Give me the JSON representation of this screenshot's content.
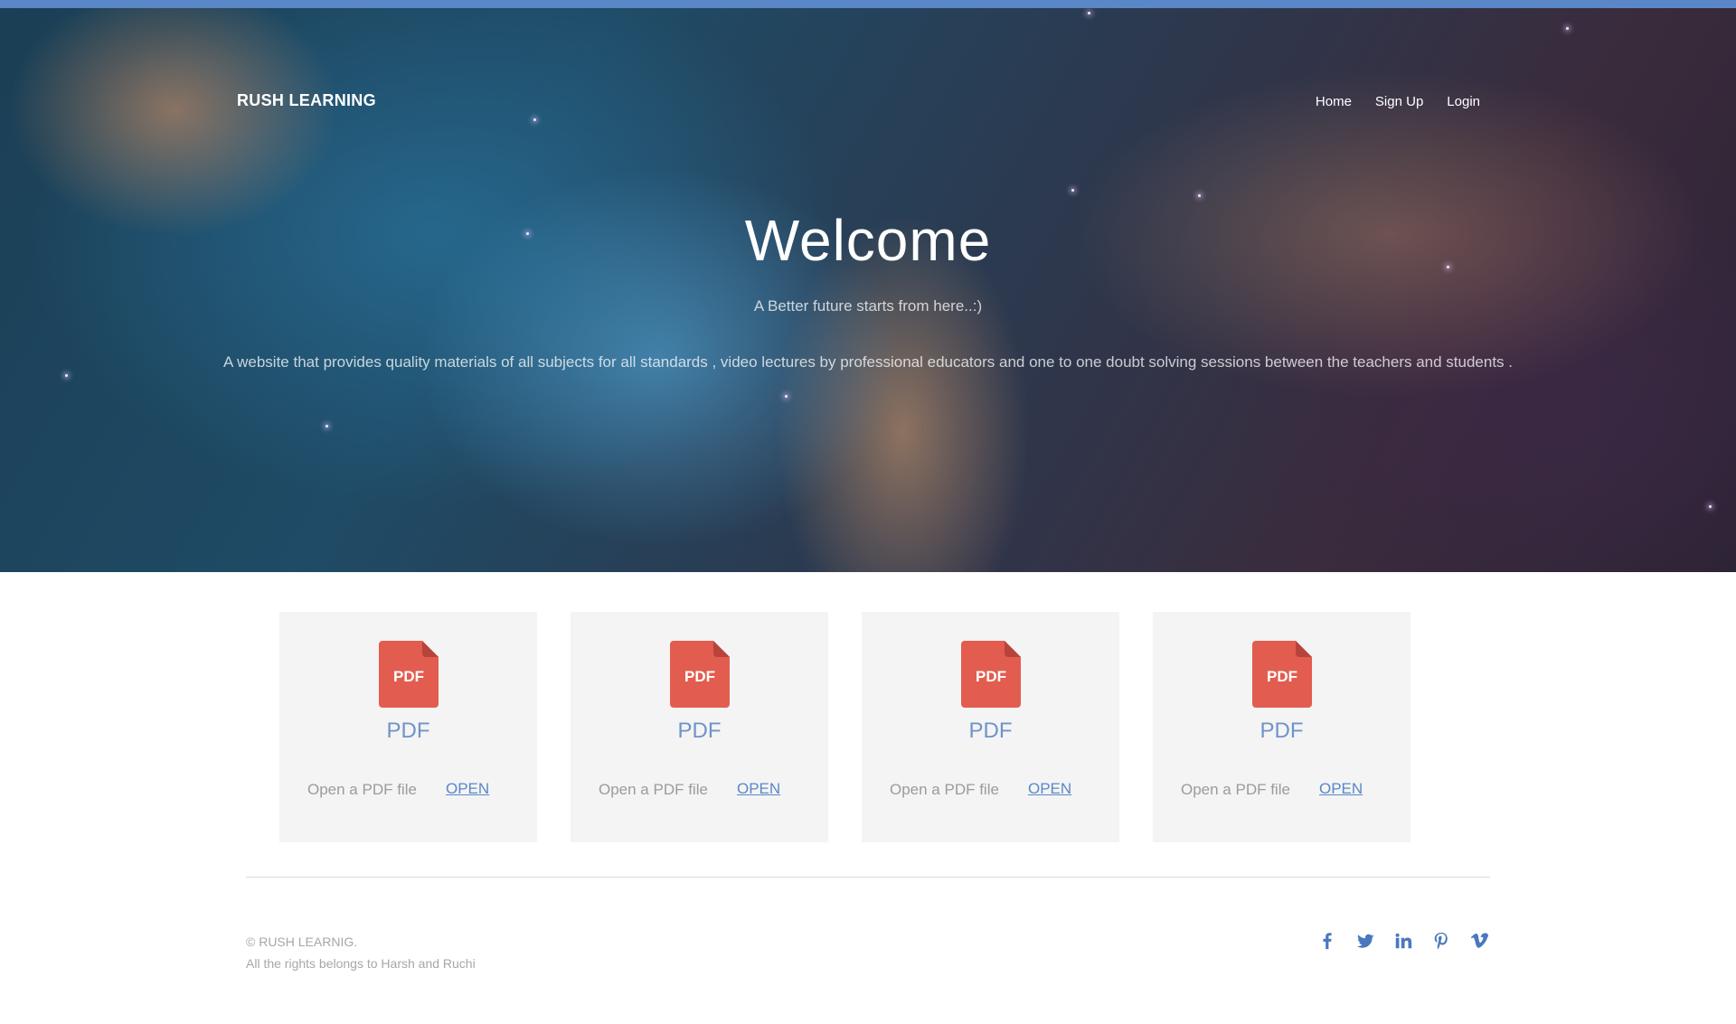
{
  "brand": "RUSH LEARNING",
  "nav": {
    "home": "Home",
    "signup": "Sign Up",
    "login": "Login"
  },
  "hero": {
    "title": "Welcome",
    "subtitle": "A Better future starts from here..:)",
    "description": "A website that provides quality materials of all subjects for all standards , video lectures by professional educators and one to one doubt solving sessions between the teachers and students ."
  },
  "cards": [
    {
      "icon": "pdf-icon",
      "icon_text": "PDF",
      "title": "PDF",
      "text": "Open a PDF file",
      "link": "OPEN"
    },
    {
      "icon": "pdf-icon",
      "icon_text": "PDF",
      "title": "PDF",
      "text": "Open a PDF file",
      "link": "OPEN"
    },
    {
      "icon": "pdf-icon",
      "icon_text": "PDF",
      "title": "PDF",
      "text": "Open a PDF file",
      "link": "OPEN"
    },
    {
      "icon": "pdf-icon",
      "icon_text": "PDF",
      "title": "PDF",
      "text": "Open a PDF file",
      "link": "OPEN"
    }
  ],
  "footer": {
    "copyright": "© RUSH LEARNIG.",
    "rights": "All the rights belongs to Harsh and Ruchi",
    "socials": [
      "facebook-icon",
      "twitter-icon",
      "linkedin-icon",
      "pinterest-icon",
      "vimeo-icon"
    ]
  },
  "colors": {
    "accent": "#5a87c8",
    "pdf_red": "#e25d4f",
    "card_bg": "#f4f4f4"
  }
}
